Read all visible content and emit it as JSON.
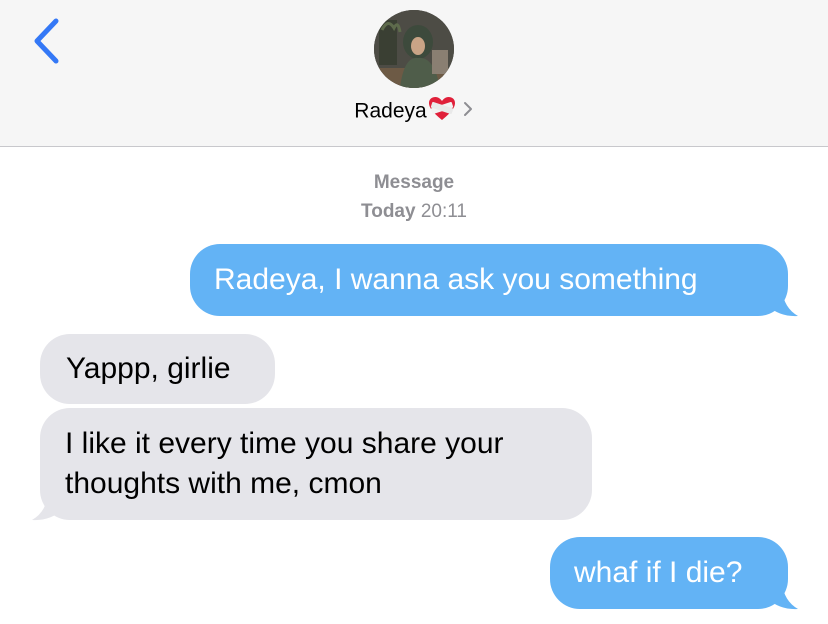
{
  "nav": {
    "back_icon": "chevron-left-icon",
    "contact_name": "Radeya",
    "contact_emoji": "mending-heart-icon",
    "disclosure_icon": "chevron-right-icon"
  },
  "thread": {
    "service": "Message",
    "day": "Today",
    "time": "20:11"
  },
  "messages": [
    {
      "from": "me",
      "text": "Radeya, I wanna ask you something"
    },
    {
      "from": "them",
      "text": "Yappp, girlie"
    },
    {
      "from": "them",
      "text": "I like it every time you share your thoughts with me, cmon"
    },
    {
      "from": "me",
      "text": "whaf if I die?"
    }
  ],
  "colors": {
    "sent_bubble": "#63b3f5",
    "received_bubble": "#e5e5ea",
    "accent": "#3478f6"
  }
}
